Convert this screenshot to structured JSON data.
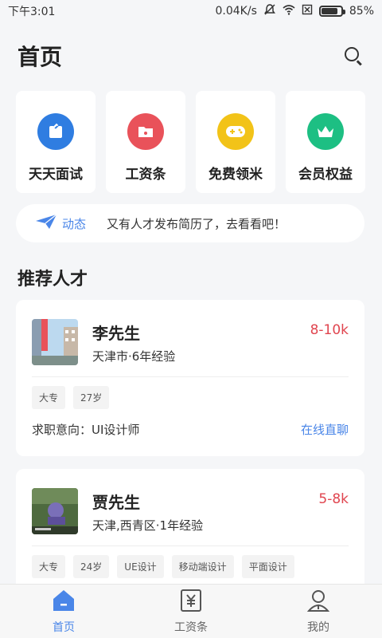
{
  "status": {
    "time": "下午3:01",
    "speed": "0.04K/s",
    "battery": "85%",
    "battery_level": 0.85
  },
  "header": {
    "title": "首页",
    "search_icon": "search-icon"
  },
  "quick_actions": [
    {
      "label": "天天面试",
      "icon": "interview-icon",
      "color": "#2f7de1"
    },
    {
      "label": "工资条",
      "icon": "folder-icon",
      "color": "#e9525a"
    },
    {
      "label": "免费领米",
      "icon": "gamepad-icon",
      "color": "#f2c318"
    },
    {
      "label": "会员权益",
      "icon": "crown-icon",
      "color": "#1dbf83"
    }
  ],
  "news": {
    "tag": "动态",
    "text": "又有人才发布简历了，去看看吧！"
  },
  "section": {
    "title": "推荐人才"
  },
  "talents": [
    {
      "name": "李先生",
      "salary": "8-10k",
      "meta": "天津市·6年经验",
      "tags": [
        "大专",
        "27岁"
      ],
      "intent": "求职意向：UI设计师",
      "chat": "在线直聊"
    },
    {
      "name": "贾先生",
      "salary": "5-8k",
      "meta": "天津,西青区·1年经验",
      "tags": [
        "大专",
        "24岁",
        "UE设计",
        "移动端设计",
        "平面设计"
      ]
    }
  ],
  "tabbar": {
    "items": [
      {
        "label": "首页",
        "icon": "home-icon"
      },
      {
        "label": "工资条",
        "icon": "yen-icon"
      },
      {
        "label": "我的",
        "icon": "user-icon"
      }
    ],
    "active_color": "#4a86e8"
  }
}
